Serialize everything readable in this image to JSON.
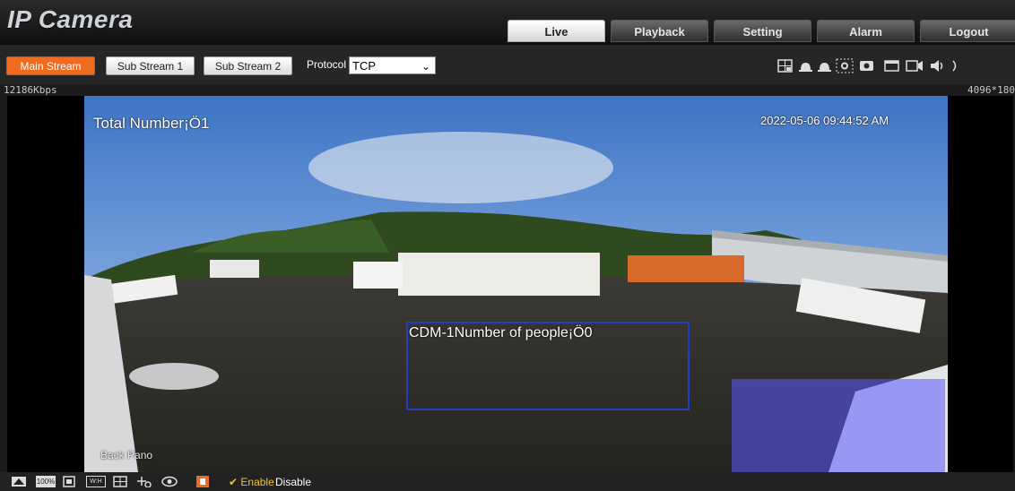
{
  "app": {
    "title": "IP Camera"
  },
  "tabs": [
    {
      "label": "Live",
      "active": true
    },
    {
      "label": "Playback",
      "active": false
    },
    {
      "label": "Setting",
      "active": false
    },
    {
      "label": "Alarm",
      "active": false
    },
    {
      "label": "Logout",
      "active": false
    }
  ],
  "streams": {
    "main": "Main Stream",
    "sub1": "Sub Stream 1",
    "sub2": "Sub Stream 2",
    "active": "Main Stream"
  },
  "protocol": {
    "label": "Protocol",
    "value": "TCP"
  },
  "status": {
    "bitrate": "12186Kbps",
    "resolution": "4096*180"
  },
  "video": {
    "total_overlay": "Total Number¡Ö1",
    "timestamp": "2022-05-06 09:44:52 AM",
    "region_overlay": "CDM-1Number of people¡Ö0",
    "mode_label": "Back Pano"
  },
  "bottom_bar": {
    "zoom": "100%",
    "wh": "W:H",
    "enable": "✔ Enable",
    "disable": "Disable"
  },
  "colors": {
    "accent": "#ef6b20",
    "region_box": "#1f3fc4",
    "region_fill": "#5a5aff",
    "enable_text": "#f1c232"
  },
  "icons": [
    "grid-icon",
    "person-icon",
    "person-icon-2",
    "zoom-region-icon",
    "snapshot-icon",
    "window-icon",
    "record-icon",
    "audio-icon",
    "info-icon"
  ]
}
